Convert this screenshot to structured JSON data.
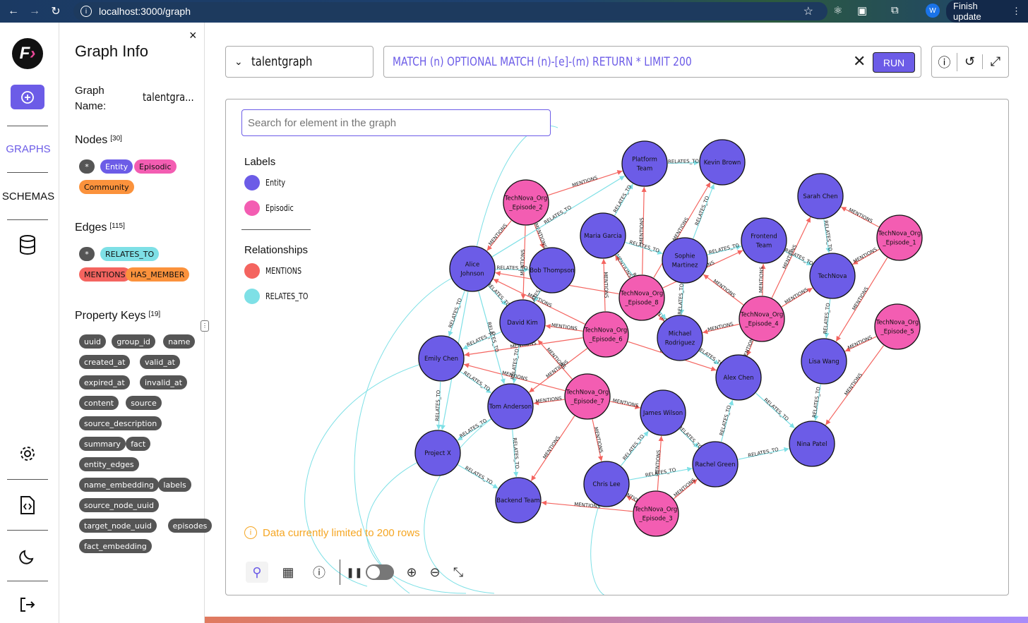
{
  "browser": {
    "url": "localhost:3000/graph",
    "profile_initial": "W",
    "finish_update": "Finish update"
  },
  "rail": {
    "graphs": "GRAPHS",
    "schemas": "SCHEMAS"
  },
  "panel": {
    "title": "Graph Info",
    "graph_name_key": "Graph Name:",
    "graph_name_value": "talentgra...",
    "nodes_label": "Nodes",
    "nodes_count": "[30]",
    "node_labels": [
      "Entity",
      "Episodic",
      "Community"
    ],
    "edges_label": "Edges",
    "edges_count": "[115]",
    "edge_labels": [
      "RELATES_TO",
      "MENTIONS",
      "HAS_MEMBER"
    ],
    "props_label": "Property Keys",
    "props_count": "[19]",
    "props": [
      "uuid",
      "group_id",
      "name",
      "created_at",
      "valid_at",
      "expired_at",
      "invalid_at",
      "content",
      "source",
      "source_description",
      "summary",
      "fact",
      "entity_edges",
      "name_embedding",
      "labels",
      "source_node_uuid",
      "target_node_uuid",
      "episodes",
      "fact_embedding"
    ]
  },
  "graph_select": "talentgraph",
  "query": {
    "text": "MATCH (n) OPTIONAL MATCH (n)-[e]-(m) RETURN * LIMIT 200",
    "run": "RUN"
  },
  "canvas": {
    "search_placeholder": "Search for element in the graph",
    "labels_title": "Labels",
    "labels": [
      {
        "name": "Entity",
        "color": "#6c5ce7"
      },
      {
        "name": "Episodic",
        "color": "#f35db2"
      }
    ],
    "relationships_title": "Relationships",
    "relationships": [
      {
        "name": "MENTIONS",
        "color": "#f4645f"
      },
      {
        "name": "RELATES_TO",
        "color": "#7ee0e6"
      }
    ],
    "warning": "Data currently limited to 200 rows"
  },
  "graph": {
    "nodes": [
      {
        "id": "platform",
        "label": "Platform Team",
        "type": "Entity"
      },
      {
        "id": "kevin",
        "label": "Kevin Brown",
        "type": "Entity"
      },
      {
        "id": "sarah",
        "label": "Sarah Chen",
        "type": "Entity"
      },
      {
        "id": "ep2",
        "label": "TechNova_Org _Episode_2",
        "type": "Episodic"
      },
      {
        "id": "maria",
        "label": "Maria Garcia",
        "type": "Entity"
      },
      {
        "id": "frontend",
        "label": "Frontend Team",
        "type": "Entity"
      },
      {
        "id": "ep1",
        "label": "TechNova_Org _Episode_1",
        "type": "Episodic"
      },
      {
        "id": "alice",
        "label": "Alice Johnson",
        "type": "Entity"
      },
      {
        "id": "bob",
        "label": "Bob Thompson",
        "type": "Entity"
      },
      {
        "id": "sophie",
        "label": "Sophie Martinez",
        "type": "Entity"
      },
      {
        "id": "technova",
        "label": "TechNova",
        "type": "Entity"
      },
      {
        "id": "ep8",
        "label": "TechNova_Org _Episode_8",
        "type": "Episodic"
      },
      {
        "id": "ep4",
        "label": "TechNova_Org _Episode_4",
        "type": "Episodic"
      },
      {
        "id": "david",
        "label": "David Kim",
        "type": "Entity"
      },
      {
        "id": "ep6",
        "label": "TechNova_Org _Episode_6",
        "type": "Episodic"
      },
      {
        "id": "michael",
        "label": "Michael Rodriguez",
        "type": "Entity"
      },
      {
        "id": "ep5",
        "label": "TechNova_Org _Episode_5",
        "type": "Episodic"
      },
      {
        "id": "emily",
        "label": "Emily Chen",
        "type": "Entity"
      },
      {
        "id": "lisa",
        "label": "Lisa Wang",
        "type": "Entity"
      },
      {
        "id": "alex",
        "label": "Alex Chen",
        "type": "Entity"
      },
      {
        "id": "tom",
        "label": "Tom Anderson",
        "type": "Entity"
      },
      {
        "id": "ep7",
        "label": "TechNova_Org _Episode_7",
        "type": "Episodic"
      },
      {
        "id": "james",
        "label": "James Wilson",
        "type": "Entity"
      },
      {
        "id": "projectx",
        "label": "Project X",
        "type": "Entity"
      },
      {
        "id": "nina",
        "label": "Nina Patel",
        "type": "Entity"
      },
      {
        "id": "rachel",
        "label": "Rachel Green",
        "type": "Entity"
      },
      {
        "id": "chris",
        "label": "Chris Lee",
        "type": "Entity"
      },
      {
        "id": "backend",
        "label": "Backend Team",
        "type": "Entity"
      },
      {
        "id": "ep3",
        "label": "TechNova_Org _Episode_3",
        "type": "Episodic"
      }
    ],
    "edges": [
      [
        "ep2",
        "platform",
        "MENTIONS"
      ],
      [
        "ep2",
        "alice",
        "MENTIONS"
      ],
      [
        "ep2",
        "bob",
        "MENTIONS"
      ],
      [
        "ep2",
        "david",
        "MENTIONS"
      ],
      [
        "ep1",
        "sarah",
        "MENTIONS"
      ],
      [
        "ep1",
        "technova",
        "MENTIONS"
      ],
      [
        "ep1",
        "lisa",
        "MENTIONS"
      ],
      [
        "ep8",
        "platform",
        "MENTIONS"
      ],
      [
        "ep8",
        "kevin",
        "MENTIONS"
      ],
      [
        "ep8",
        "maria",
        "MENTIONS"
      ],
      [
        "ep8",
        "alice",
        "MENTIONS"
      ],
      [
        "ep8",
        "michael",
        "MENTIONS"
      ],
      [
        "ep8",
        "frontend",
        "MENTIONS"
      ],
      [
        "ep4",
        "sophie",
        "MENTIONS"
      ],
      [
        "ep4",
        "technova",
        "MENTIONS"
      ],
      [
        "ep4",
        "frontend",
        "MENTIONS"
      ],
      [
        "ep4",
        "sarah",
        "MENTIONS"
      ],
      [
        "ep4",
        "michael",
        "MENTIONS"
      ],
      [
        "ep4",
        "alex",
        "MENTIONS"
      ],
      [
        "ep6",
        "alice",
        "MENTIONS"
      ],
      [
        "ep6",
        "david",
        "MENTIONS"
      ],
      [
        "ep6",
        "emily",
        "MENTIONS"
      ],
      [
        "ep6",
        "tom",
        "MENTIONS"
      ],
      [
        "ep6",
        "alex",
        "MENTIONS"
      ],
      [
        "ep6",
        "maria",
        "MENTIONS"
      ],
      [
        "ep5",
        "lisa",
        "MENTIONS"
      ],
      [
        "ep5",
        "nina",
        "MENTIONS"
      ],
      [
        "ep7",
        "tom",
        "MENTIONS"
      ],
      [
        "ep7",
        "james",
        "MENTIONS"
      ],
      [
        "ep7",
        "backend",
        "MENTIONS"
      ],
      [
        "ep7",
        "david",
        "MENTIONS"
      ],
      [
        "ep7",
        "emily",
        "MENTIONS"
      ],
      [
        "ep7",
        "chris",
        "MENTIONS"
      ],
      [
        "ep3",
        "chris",
        "MENTIONS"
      ],
      [
        "ep3",
        "rachel",
        "MENTIONS"
      ],
      [
        "ep3",
        "backend",
        "MENTIONS"
      ],
      [
        "ep3",
        "james",
        "MENTIONS"
      ],
      [
        "alice",
        "bob",
        "RELATES_TO"
      ],
      [
        "alice",
        "david",
        "RELATES_TO"
      ],
      [
        "alice",
        "emily",
        "RELATES_TO"
      ],
      [
        "alice",
        "projectx",
        "RELATES_TO"
      ],
      [
        "alice",
        "tom",
        "RELATES_TO"
      ],
      [
        "maria",
        "platform",
        "RELATES_TO"
      ],
      [
        "maria",
        "sophie",
        "RELATES_TO"
      ],
      [
        "maria",
        "michael",
        "RELATES_TO"
      ],
      [
        "sophie",
        "frontend",
        "RELATES_TO"
      ],
      [
        "sophie",
        "kevin",
        "RELATES_TO"
      ],
      [
        "sophie",
        "michael",
        "RELATES_TO"
      ],
      [
        "sarah",
        "technova",
        "RELATES_TO"
      ],
      [
        "frontend",
        "technova",
        "RELATES_TO"
      ],
      [
        "technova",
        "lisa",
        "RELATES_TO"
      ],
      [
        "lisa",
        "nina",
        "RELATES_TO"
      ],
      [
        "alex",
        "nina",
        "RELATES_TO"
      ],
      [
        "rachel",
        "nina",
        "RELATES_TO"
      ],
      [
        "rachel",
        "alex",
        "RELATES_TO"
      ],
      [
        "james",
        "rachel",
        "RELATES_TO"
      ],
      [
        "chris",
        "rachel",
        "RELATES_TO"
      ],
      [
        "chris",
        "james",
        "RELATES_TO"
      ],
      [
        "emily",
        "tom",
        "RELATES_TO"
      ],
      [
        "emily",
        "projectx",
        "RELATES_TO"
      ],
      [
        "tom",
        "projectx",
        "RELATES_TO"
      ],
      [
        "tom",
        "backend",
        "RELATES_TO"
      ],
      [
        "david",
        "tom",
        "RELATES_TO"
      ],
      [
        "david",
        "emily",
        "RELATES_TO"
      ],
      [
        "michael",
        "alex",
        "RELATES_TO"
      ],
      [
        "bob",
        "david",
        "RELATES_TO"
      ],
      [
        "platform",
        "kevin",
        "RELATES_TO"
      ],
      [
        "alice",
        "platform",
        "RELATES_TO"
      ],
      [
        "projectx",
        "backend",
        "RELATES_TO"
      ]
    ]
  }
}
